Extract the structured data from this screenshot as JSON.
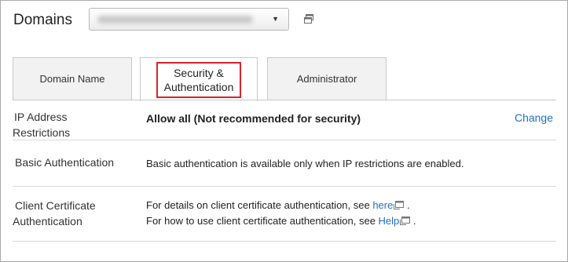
{
  "header": {
    "title": "Domains",
    "domain_select_value": ""
  },
  "tabs": [
    {
      "label": "Domain Name",
      "active": false
    },
    {
      "label_line1": "Security &",
      "label_line2": "Authentication",
      "active": true
    },
    {
      "label": "Administrator",
      "active": false
    }
  ],
  "rows": {
    "ip": {
      "label_line1": "IP Address",
      "label_line2": "Restrictions",
      "value": "Allow all (Not recommended for security)",
      "action": "Change"
    },
    "basic": {
      "label": "Basic Authentication",
      "value": "Basic authentication is available only when IP restrictions are enabled."
    },
    "client": {
      "label_line1": "Client Certificate",
      "label_line2": "Authentication",
      "line1_prefix": "For details on client certificate authentication, see ",
      "line1_link": "here",
      "line1_suffix": " .",
      "line2_prefix": "For how to use client certificate authentication, see ",
      "line2_link": "Help",
      "line2_suffix": " ."
    }
  },
  "colors": {
    "link": "#1f6fc5",
    "highlight_border": "#d9232e"
  },
  "icons": {
    "popup": "open-in-window-icon",
    "external_link": "external-link-icon",
    "dropdown": "chevron-down-icon"
  }
}
